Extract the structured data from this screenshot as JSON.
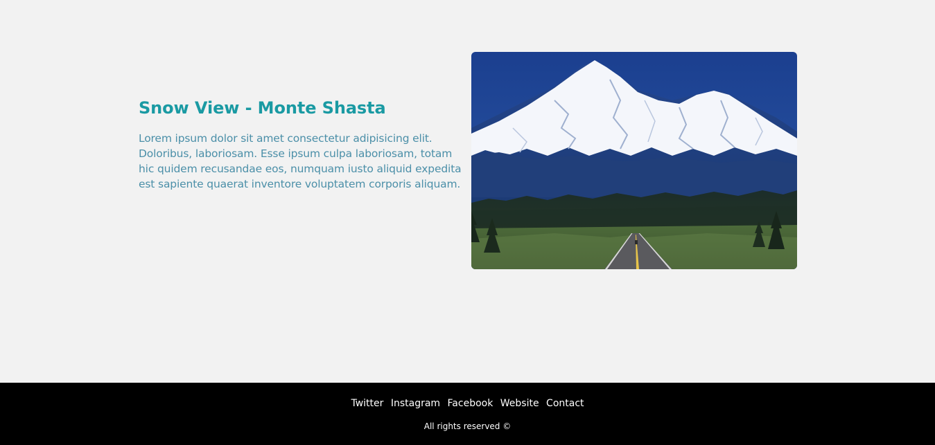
{
  "content": {
    "title": "Snow View - Monte Shasta",
    "description": "Lorem ipsum dolor sit amet consectetur adipisicing elit. Doloribus, laboriosam. Esse ipsum culpa laboriosam, totam hic quidem recusandae eos, numquam iusto aliquid expedita est sapiente quaerat inventore voluptatem corporis aliquam."
  },
  "image": {
    "subject": "snow-capped mountain with road"
  },
  "footer": {
    "links": [
      "Twitter",
      "Instagram",
      "Facebook",
      "Website",
      "Contact"
    ],
    "copyright": "All rights reserved ©"
  },
  "colors": {
    "page_background": "#f2f2f2",
    "title": "#1a9aa3",
    "description": "#4b8fa8",
    "footer_background": "#000000",
    "footer_text": "#ffffff"
  }
}
